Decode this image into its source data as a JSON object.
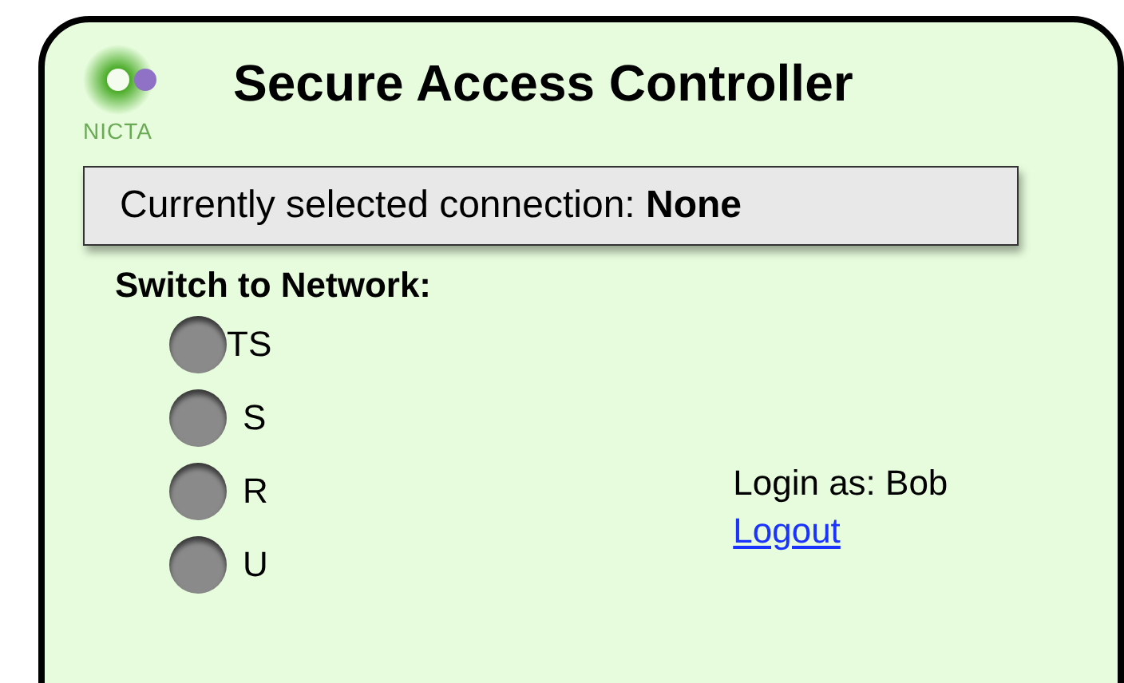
{
  "logo": {
    "text": "NICTA"
  },
  "title": "Secure Access Controller",
  "connection_status": "Currently selected connection: **None**",
  "network_heading": "Switch to Network:",
  "networks": [
    {
      "label": "TS",
      "selected": false
    },
    {
      "label": "S",
      "selected": false
    },
    {
      "label": "R",
      "selected": false
    },
    {
      "label": "U",
      "selected": false
    }
  ],
  "login": {
    "text": "Login as: Bob",
    "logout_link": "Logout"
  }
}
